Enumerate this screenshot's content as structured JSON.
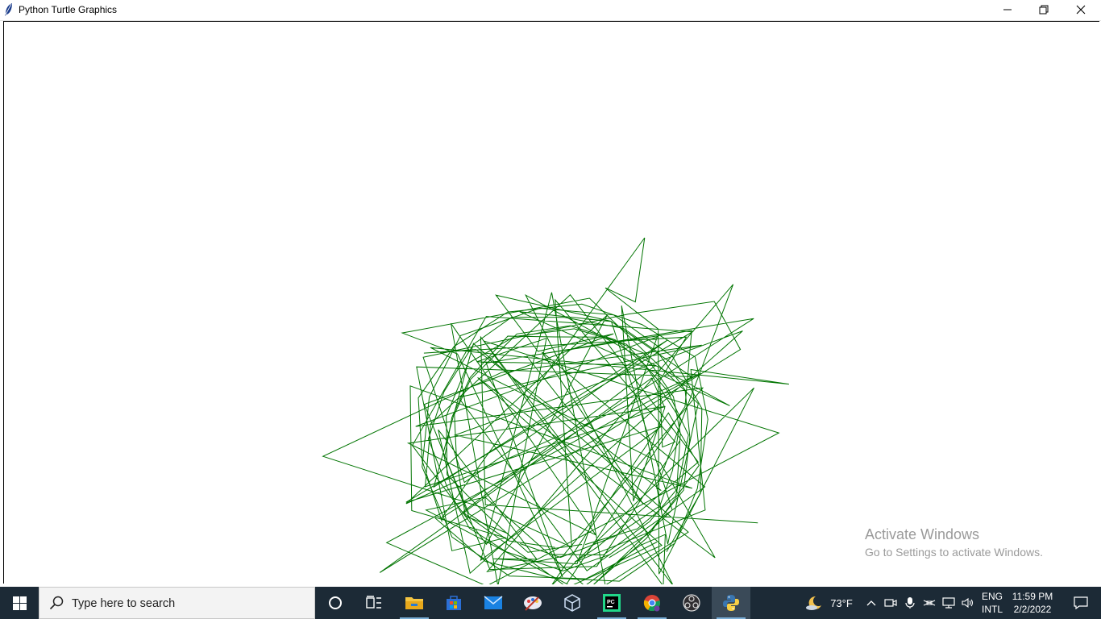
{
  "window": {
    "title": "Python Turtle Graphics",
    "controls": {
      "minimize": "minimize",
      "restore": "restore",
      "close": "close"
    }
  },
  "canvas": {
    "background": "#ffffff",
    "pen_color": "#007400",
    "drawing": "random green star-burst line drawing"
  },
  "watermark": {
    "title": "Activate Windows",
    "subtitle": "Go to Settings to activate Windows."
  },
  "taskbar": {
    "search_placeholder": "Type here to search",
    "apps": [
      {
        "name": "cortana",
        "icon": "circle-icon"
      },
      {
        "name": "task-view",
        "icon": "task-view-icon"
      },
      {
        "name": "file-explorer",
        "icon": "folder-icon"
      },
      {
        "name": "microsoft-store",
        "icon": "store-icon"
      },
      {
        "name": "mail",
        "icon": "mail-icon"
      },
      {
        "name": "paint",
        "icon": "palette-icon"
      },
      {
        "name": "virtualbox",
        "icon": "cube-icon"
      },
      {
        "name": "pycharm",
        "icon": "pycharm-icon"
      },
      {
        "name": "chrome",
        "icon": "chrome-icon"
      },
      {
        "name": "obs",
        "icon": "obs-icon"
      },
      {
        "name": "python",
        "icon": "python-icon"
      }
    ],
    "tray": {
      "weather": "73°F",
      "lang_top": "ENG",
      "lang_bottom": "INTL",
      "time": "11:59 PM",
      "date": "2/2/2022"
    }
  }
}
